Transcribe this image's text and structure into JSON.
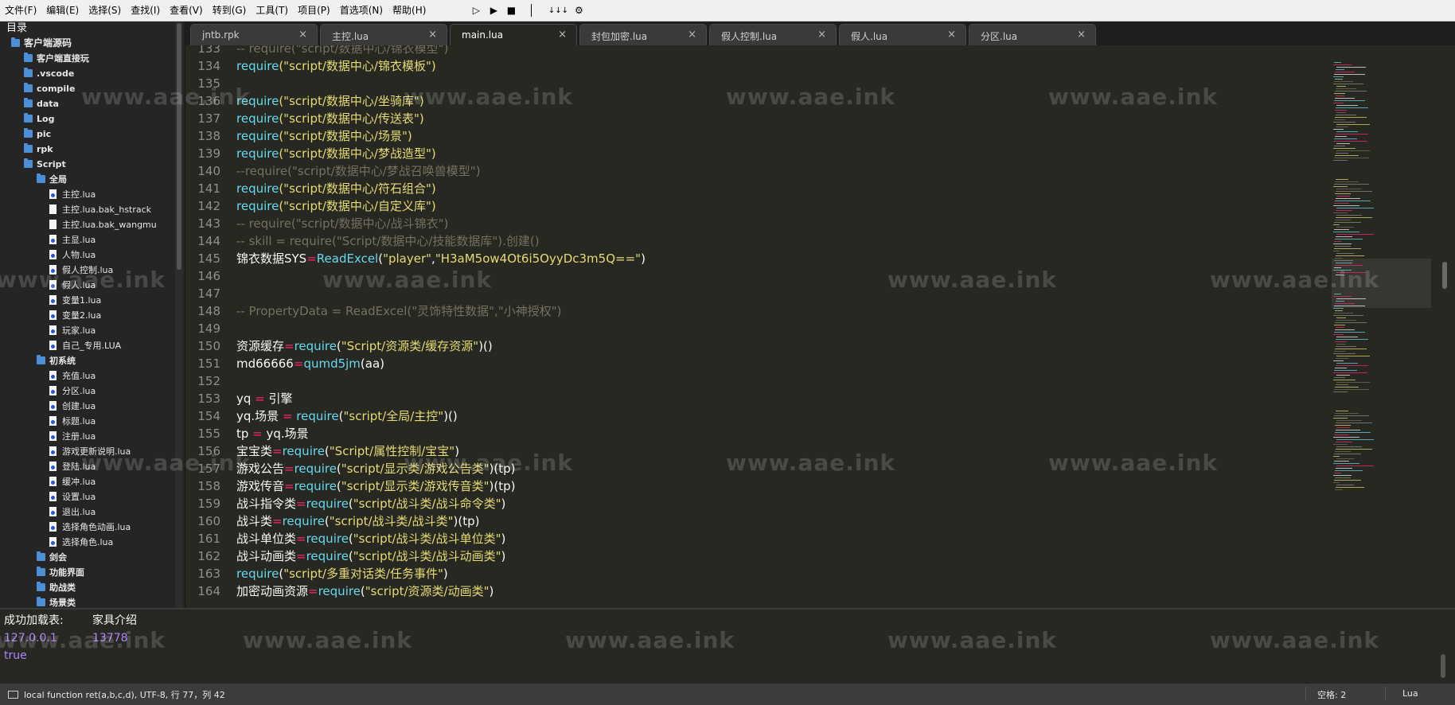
{
  "menu": [
    "文件(F)",
    "编辑(E)",
    "选择(S)",
    "查找(I)",
    "查看(V)",
    "转到(G)",
    "工具(T)",
    "项目(P)",
    "首选项(N)",
    "帮助(H)"
  ],
  "toolbar": {
    "run": "▷",
    "run_alt": "▶",
    "stop": "■",
    "sep": "|",
    "step": "↓↓↓",
    "settings": "⚙"
  },
  "sidebar": {
    "title": "目录",
    "items": [
      {
        "label": "客户端源码",
        "type": "folder",
        "depth": 0
      },
      {
        "label": "客户端直接玩",
        "type": "folder",
        "depth": 1
      },
      {
        "label": ".vscode",
        "type": "folder",
        "depth": 1
      },
      {
        "label": "compile",
        "type": "folder",
        "depth": 1
      },
      {
        "label": "data",
        "type": "folder",
        "depth": 1
      },
      {
        "label": "Log",
        "type": "folder",
        "depth": 1
      },
      {
        "label": "pic",
        "type": "folder",
        "depth": 1
      },
      {
        "label": "rpk",
        "type": "folder",
        "depth": 1
      },
      {
        "label": "Script",
        "type": "folder",
        "depth": 1
      },
      {
        "label": "全局",
        "type": "folder",
        "depth": 2
      },
      {
        "label": "主控.lua",
        "type": "lua",
        "depth": 3
      },
      {
        "label": "主控.lua.bak_hstrack",
        "type": "file",
        "depth": 3
      },
      {
        "label": "主控.lua.bak_wangmu",
        "type": "file",
        "depth": 3
      },
      {
        "label": "主显.lua",
        "type": "lua",
        "depth": 3
      },
      {
        "label": "人物.lua",
        "type": "lua",
        "depth": 3
      },
      {
        "label": "假人控制.lua",
        "type": "lua",
        "depth": 3
      },
      {
        "label": "假人.lua",
        "type": "lua",
        "depth": 3
      },
      {
        "label": "变量1.lua",
        "type": "lua",
        "depth": 3
      },
      {
        "label": "变量2.lua",
        "type": "lua",
        "depth": 3
      },
      {
        "label": "玩家.lua",
        "type": "lua",
        "depth": 3
      },
      {
        "label": "自己_专用.LUA",
        "type": "lua",
        "depth": 3
      },
      {
        "label": "初系统",
        "type": "folder",
        "depth": 2
      },
      {
        "label": "充值.lua",
        "type": "lua",
        "depth": 3
      },
      {
        "label": "分区.lua",
        "type": "lua",
        "depth": 3
      },
      {
        "label": "创建.lua",
        "type": "lua",
        "depth": 3
      },
      {
        "label": "标题.lua",
        "type": "lua",
        "depth": 3
      },
      {
        "label": "注册.lua",
        "type": "lua",
        "depth": 3
      },
      {
        "label": "游戏更新说明.lua",
        "type": "lua",
        "depth": 3
      },
      {
        "label": "登陆.lua",
        "type": "lua",
        "depth": 3
      },
      {
        "label": "缓冲.lua",
        "type": "lua",
        "depth": 3
      },
      {
        "label": "设置.lua",
        "type": "lua",
        "depth": 3
      },
      {
        "label": "退出.lua",
        "type": "lua",
        "depth": 3
      },
      {
        "label": "选择角色动画.lua",
        "type": "lua",
        "depth": 3
      },
      {
        "label": "选择角色.lua",
        "type": "lua",
        "depth": 3
      },
      {
        "label": "剑会",
        "type": "folder",
        "depth": 2
      },
      {
        "label": "功能界面",
        "type": "folder",
        "depth": 2
      },
      {
        "label": "助战类",
        "type": "folder",
        "depth": 2
      },
      {
        "label": "场景类",
        "type": "folder",
        "depth": 2
      }
    ]
  },
  "tabs": [
    {
      "label": "jntb.rpk",
      "active": false
    },
    {
      "label": "主控.lua",
      "active": false
    },
    {
      "label": "main.lua",
      "active": true
    },
    {
      "label": "封包加密.lua",
      "active": false
    },
    {
      "label": "假人控制.lua",
      "active": false
    },
    {
      "label": "假人.lua",
      "active": false
    },
    {
      "label": "分区.lua",
      "active": false
    }
  ],
  "tab_close": "×",
  "code": [
    {
      "n": "133",
      "t": [
        [
          "cmt",
          "-- require(\"script/数据中心/锦衣模型\")"
        ]
      ]
    },
    {
      "n": "134",
      "t": [
        [
          "fn",
          "require"
        ],
        [
          "str",
          "(\"script/数据中心/锦衣模板\")"
        ]
      ]
    },
    {
      "n": "135",
      "t": []
    },
    {
      "n": "136",
      "t": [
        [
          "fn",
          "require"
        ],
        [
          "str",
          "(\"script/数据中心/坐骑库\")"
        ]
      ]
    },
    {
      "n": "137",
      "t": [
        [
          "fn",
          "require"
        ],
        [
          "str",
          "(\"script/数据中心/传送表\")"
        ]
      ]
    },
    {
      "n": "138",
      "t": [
        [
          "fn",
          "require"
        ],
        [
          "str",
          "(\"script/数据中心/场景\")"
        ]
      ]
    },
    {
      "n": "139",
      "t": [
        [
          "fn",
          "require"
        ],
        [
          "str",
          "(\"script/数据中心/梦战造型\")"
        ]
      ]
    },
    {
      "n": "140",
      "t": [
        [
          "cmt",
          "--require(\"script/数据中心/梦战召唤兽模型\")"
        ]
      ]
    },
    {
      "n": "141",
      "t": [
        [
          "fn",
          "require"
        ],
        [
          "str",
          "(\"script/数据中心/符石组合\")"
        ]
      ]
    },
    {
      "n": "142",
      "t": [
        [
          "fn",
          "require"
        ],
        [
          "str",
          "(\"script/数据中心/自定义库\")"
        ]
      ]
    },
    {
      "n": "143",
      "t": [
        [
          "cmt",
          "-- require(\"script/数据中心/战斗锦衣\")"
        ]
      ]
    },
    {
      "n": "144",
      "t": [
        [
          "cmt",
          "-- skill = require(\"Script/数据中心/技能数据库\").创建()"
        ]
      ]
    },
    {
      "n": "145",
      "t": [
        [
          "plain",
          "锦衣数据SYS"
        ],
        [
          "op",
          "="
        ],
        [
          "fn",
          "ReadExcel"
        ],
        [
          "plain",
          "("
        ],
        [
          "str",
          "\"player\""
        ],
        [
          "plain",
          ","
        ],
        [
          "str",
          "\"H3aM5ow4Ot6i5OyyDc3m5Q==\""
        ],
        [
          "plain",
          ")"
        ]
      ]
    },
    {
      "n": "146",
      "t": []
    },
    {
      "n": "147",
      "t": []
    },
    {
      "n": "148",
      "t": [
        [
          "cmt",
          "-- PropertyData = ReadExcel(\"灵饰特性数据\",\"小神授权\")"
        ]
      ]
    },
    {
      "n": "149",
      "t": []
    },
    {
      "n": "150",
      "t": [
        [
          "plain",
          "资源缓存"
        ],
        [
          "op",
          "="
        ],
        [
          "fn",
          "require"
        ],
        [
          "plain",
          "("
        ],
        [
          "str",
          "\"Script/资源类/缓存资源\""
        ],
        [
          "plain",
          ")()"
        ]
      ]
    },
    {
      "n": "151",
      "t": [
        [
          "plain",
          "md66666"
        ],
        [
          "op",
          "="
        ],
        [
          "fn",
          "qumd5jm"
        ],
        [
          "plain",
          "(aa)"
        ]
      ]
    },
    {
      "n": "152",
      "t": []
    },
    {
      "n": "153",
      "t": [
        [
          "plain",
          "yq "
        ],
        [
          "op",
          "="
        ],
        [
          "plain",
          " 引擎"
        ]
      ]
    },
    {
      "n": "154",
      "t": [
        [
          "plain",
          "yq.场景 "
        ],
        [
          "op",
          "="
        ],
        [
          "fn",
          " require"
        ],
        [
          "plain",
          "("
        ],
        [
          "str",
          "\"script/全局/主控\""
        ],
        [
          "plain",
          ")()"
        ]
      ]
    },
    {
      "n": "155",
      "t": [
        [
          "plain",
          "tp "
        ],
        [
          "op",
          "="
        ],
        [
          "plain",
          " yq.场景"
        ]
      ]
    },
    {
      "n": "156",
      "t": [
        [
          "plain",
          "宝宝类"
        ],
        [
          "op",
          "="
        ],
        [
          "fn",
          "require"
        ],
        [
          "plain",
          "("
        ],
        [
          "str",
          "\"Script/属性控制/宝宝\""
        ],
        [
          "plain",
          ")"
        ]
      ]
    },
    {
      "n": "157",
      "t": [
        [
          "plain",
          "游戏公告"
        ],
        [
          "op",
          "="
        ],
        [
          "fn",
          "require"
        ],
        [
          "plain",
          "("
        ],
        [
          "str",
          "\"script/显示类/游戏公告类\""
        ],
        [
          "plain",
          ")(tp)"
        ]
      ]
    },
    {
      "n": "158",
      "t": [
        [
          "plain",
          "游戏传音"
        ],
        [
          "op",
          "="
        ],
        [
          "fn",
          "require"
        ],
        [
          "plain",
          "("
        ],
        [
          "str",
          "\"script/显示类/游戏传音类\""
        ],
        [
          "plain",
          ")(tp)"
        ]
      ]
    },
    {
      "n": "159",
      "t": [
        [
          "plain",
          "战斗指令类"
        ],
        [
          "op",
          "="
        ],
        [
          "fn",
          "require"
        ],
        [
          "plain",
          "("
        ],
        [
          "str",
          "\"script/战斗类/战斗命令类\""
        ],
        [
          "plain",
          ")"
        ]
      ]
    },
    {
      "n": "160",
      "t": [
        [
          "plain",
          "战斗类"
        ],
        [
          "op",
          "="
        ],
        [
          "fn",
          "require"
        ],
        [
          "plain",
          "("
        ],
        [
          "str",
          "\"script/战斗类/战斗类\""
        ],
        [
          "plain",
          ")(tp)"
        ]
      ]
    },
    {
      "n": "161",
      "t": [
        [
          "plain",
          "战斗单位类"
        ],
        [
          "op",
          "="
        ],
        [
          "fn",
          "require"
        ],
        [
          "plain",
          "("
        ],
        [
          "str",
          "\"script/战斗类/战斗单位类\""
        ],
        [
          "plain",
          ")"
        ]
      ]
    },
    {
      "n": "162",
      "t": [
        [
          "plain",
          "战斗动画类"
        ],
        [
          "op",
          "="
        ],
        [
          "fn",
          "require"
        ],
        [
          "plain",
          "("
        ],
        [
          "str",
          "\"script/战斗类/战斗动画类\""
        ],
        [
          "plain",
          ")"
        ]
      ]
    },
    {
      "n": "163",
      "t": [
        [
          "fn",
          "require"
        ],
        [
          "plain",
          "("
        ],
        [
          "str",
          "\"script/多重对话类/任务事件\""
        ],
        [
          "plain",
          ")"
        ]
      ]
    },
    {
      "n": "164",
      "t": [
        [
          "plain",
          "加密动画资源"
        ],
        [
          "op",
          "="
        ],
        [
          "fn",
          "require"
        ],
        [
          "plain",
          "("
        ],
        [
          "str",
          "\"script/资源类/动画类\""
        ],
        [
          "plain",
          ")"
        ]
      ]
    }
  ],
  "console": {
    "row1_key": "成功加载表:",
    "row1_val": "家具介绍",
    "row2_key": "127.0.0.1",
    "row2_val": "13778",
    "row3": "true"
  },
  "status": {
    "text": "local function ret(a,b,c,d), UTF-8, 行 77，列 42",
    "indent": "空格: 2",
    "syntax": "Lua"
  },
  "watermark": "www.aae.ink",
  "colors": {
    "keyword_fn": "#66d9ef",
    "string": "#e6db74",
    "operator": "#f92672",
    "comment": "#75715e",
    "console_value": "#ae81ff",
    "folder": "#4d8fd6"
  }
}
